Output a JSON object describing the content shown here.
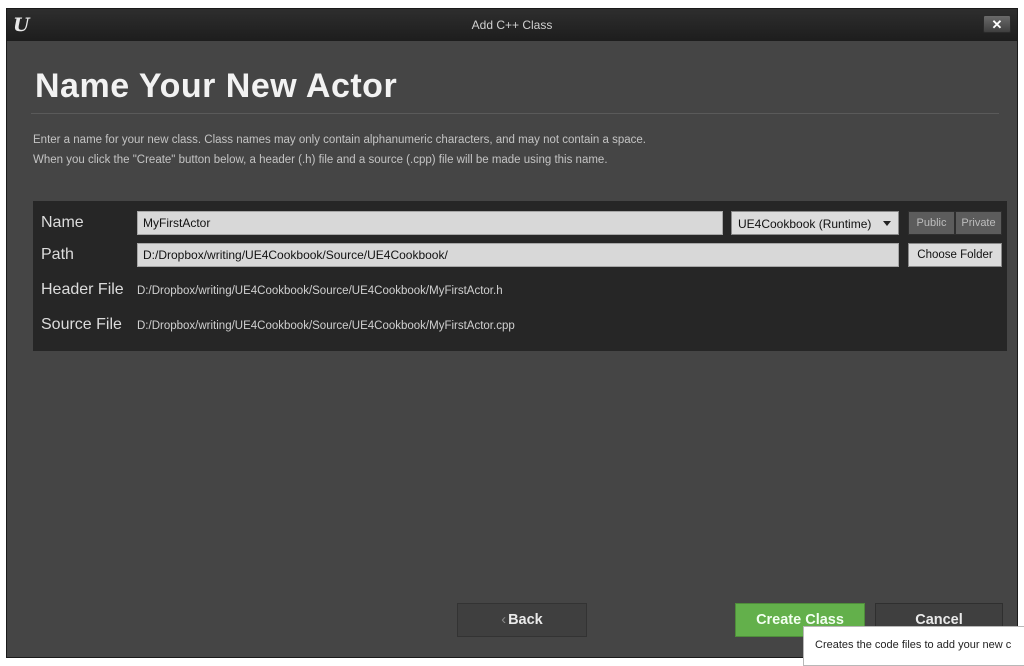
{
  "window": {
    "title": "Add C++ Class",
    "logo": "U",
    "close_glyph": "✕"
  },
  "page": {
    "heading": "Name Your New Actor",
    "description_line1": "Enter a name for your new class. Class names may only contain alphanumeric characters, and may not contain a space.",
    "description_line2": "When you click the \"Create\" button below, a header (.h) file and a source (.cpp) file will be made using this name."
  },
  "form": {
    "name_label": "Name",
    "name_value": "MyFirstActor",
    "module_selected": "UE4Cookbook (Runtime)",
    "visibility_options": [
      "Public",
      "Private"
    ],
    "path_label": "Path",
    "path_value": "D:/Dropbox/writing/UE4Cookbook/Source/UE4Cookbook/",
    "choose_folder_label": "Choose Folder",
    "header_file_label": "Header File",
    "header_file_value": "D:/Dropbox/writing/UE4Cookbook/Source/UE4Cookbook/MyFirstActor.h",
    "source_file_label": "Source File",
    "source_file_value": "D:/Dropbox/writing/UE4Cookbook/Source/UE4Cookbook/MyFirstActor.cpp"
  },
  "buttons": {
    "back": "Back",
    "back_chevron": "‹",
    "create_class": "Create Class",
    "cancel": "Cancel"
  },
  "tooltip": {
    "text": "Creates the code files to add your new c"
  }
}
